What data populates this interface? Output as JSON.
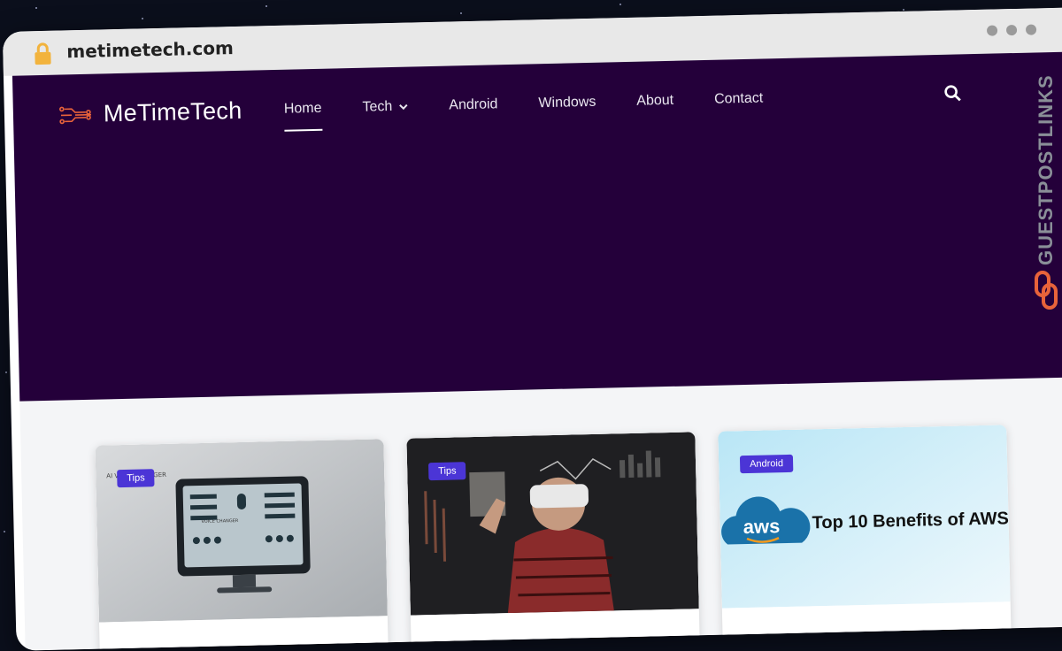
{
  "browser": {
    "url": "metimetech.com"
  },
  "site": {
    "brand": "MeTimeTech",
    "nav": [
      {
        "label": "Home",
        "active": true
      },
      {
        "label": "Tech",
        "dropdown": true
      },
      {
        "label": "Android"
      },
      {
        "label": "Windows"
      },
      {
        "label": "About"
      },
      {
        "label": "Contact"
      }
    ]
  },
  "cards": [
    {
      "tag": "Tips",
      "image": "ai-voice-changer-monitor-illustration",
      "image_text_1": "AI VOICE CHANGER",
      "image_text_2": "VOICE CHANGER"
    },
    {
      "tag": "Tips",
      "image": "man-with-vr-headset-photo"
    },
    {
      "tag": "Android",
      "image": "aws-cloud-banner",
      "image_text": "Top 10 Benefits of AWS",
      "logo_text": "aws"
    }
  ],
  "watermark": {
    "text": "GUESTPOSTLINKS"
  },
  "colors": {
    "hero_bg": "#24003a",
    "tag_bg": "#4b35d6",
    "watermark": "#8a8f98",
    "watermark_accent": "#e8633a"
  }
}
